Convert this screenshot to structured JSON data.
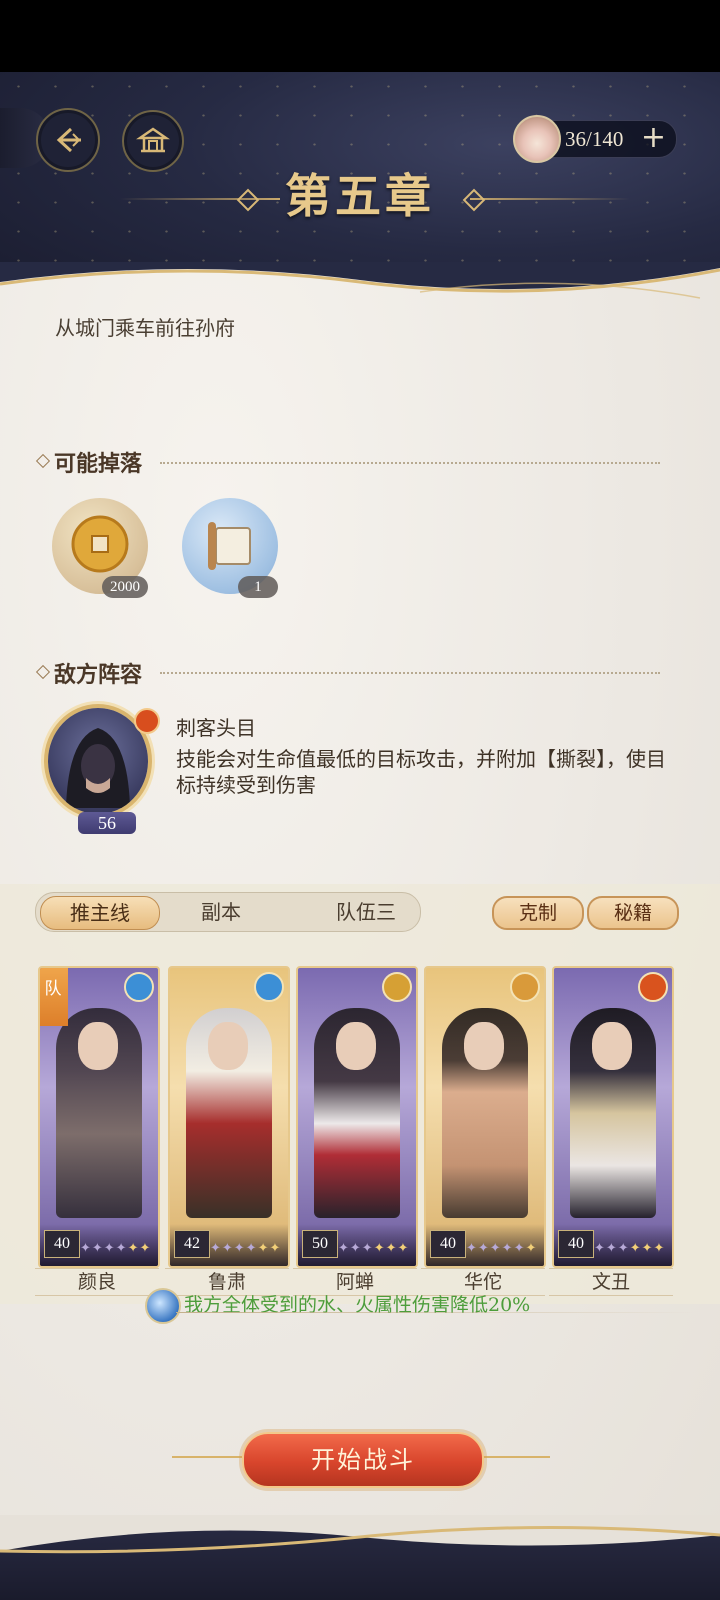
{
  "header": {
    "chapter_title": "第五章",
    "stamina": {
      "value": "36/140",
      "plus_label": "+"
    }
  },
  "stage": {
    "description": "从城门乘车前往孙府"
  },
  "drops": {
    "title": "可能掉落",
    "items": [
      {
        "name": "coin",
        "count": "2000"
      },
      {
        "name": "scroll",
        "count": "1"
      }
    ]
  },
  "enemy": {
    "title": "敌方阵容",
    "name": "刺客头目",
    "level": "56",
    "element": "fire",
    "skill": "技能会对生命值最低的目标攻击，并附加【撕裂】，使目标持续受到伤害"
  },
  "team": {
    "tabs": [
      "推主线",
      "副本",
      "队伍三"
    ],
    "active_tab": 0,
    "buttons": {
      "counter": "克制",
      "secret": "秘籍"
    },
    "leader_label": "队",
    "members": [
      {
        "name": "颜良",
        "level": "40",
        "element": "water",
        "stars_filled": 2,
        "stars_total": 6
      },
      {
        "name": "鲁肃",
        "level": "42",
        "element": "water",
        "stars_filled": 2,
        "stars_total": 6
      },
      {
        "name": "阿蝉",
        "level": "50",
        "element": "earth",
        "stars_filled": 3,
        "stars_total": 6
      },
      {
        "name": "华佗",
        "level": "40",
        "element": "moon",
        "stars_filled": 1,
        "stars_total": 6
      },
      {
        "name": "文丑",
        "level": "40",
        "element": "fire",
        "stars_filled": 3,
        "stars_total": 6
      }
    ],
    "buff_text": "我方全体受到的水、火属性伤害降低20%"
  },
  "actions": {
    "start_battle": "开始战斗"
  },
  "colors": {
    "accent_gold": "#e7c98b",
    "start_red": "#d8452c",
    "buff_green": "#4d9d3b"
  }
}
